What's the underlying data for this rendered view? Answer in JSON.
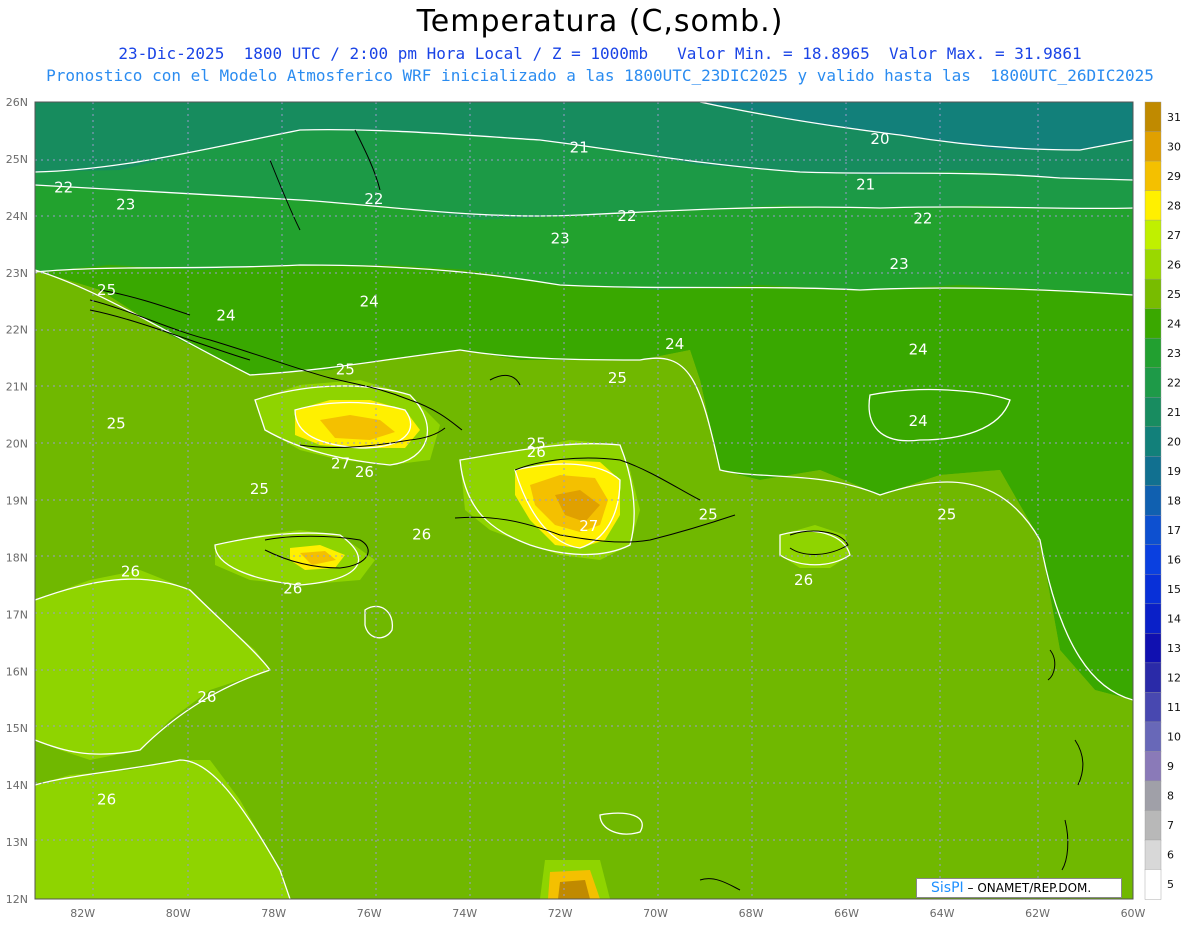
{
  "header": {
    "title": "Temperatura (C,somb.)",
    "line1": "23-Dic-2025  1800 UTC / 2:00 pm Hora Local / Z = 1000mb   Valor Min. = 18.8965  Valor Max. = 31.9861",
    "line2": "Pronostico con el Modelo Atmosferico WRF inicializado a las 1800UTC_23DIC2025 y valido hasta las  1800UTC_26DIC2025"
  },
  "map": {
    "lon_range": [
      -83,
      -60
    ],
    "lat_range": [
      12,
      26
    ],
    "lat_labels": [
      "26N",
      "25N",
      "24N",
      "23N",
      "22N",
      "21N",
      "20N",
      "19N",
      "18N",
      "17N",
      "16N",
      "15N",
      "14N",
      "13N",
      "12N"
    ],
    "lon_labels": [
      "82W",
      "80W",
      "78W",
      "76W",
      "74W",
      "72W",
      "70W",
      "68W",
      "66W",
      "64W",
      "62W",
      "60W"
    ]
  },
  "colorbar": {
    "labels": [
      "31",
      "30",
      "29",
      "28",
      "27",
      "26",
      "25",
      "24",
      "23",
      "22",
      "21",
      "20",
      "19",
      "18",
      "17",
      "16",
      "15",
      "14",
      "13",
      "12",
      "11",
      "10",
      "9",
      "8",
      "7",
      "6",
      "5"
    ],
    "colors": [
      "#c08a00",
      "#e0a000",
      "#f4c000",
      "#fff000",
      "#c0f000",
      "#9ad800",
      "#78bc00",
      "#3aa800",
      "#22a030",
      "#1e9a48",
      "#188c60",
      "#12807a",
      "#117090",
      "#1060b0",
      "#0d50d0",
      "#0a40e0",
      "#0830d8",
      "#0a20c8",
      "#1010b0",
      "#2a2aa8",
      "#4848b0",
      "#6868b8",
      "#8a7ab8",
      "#a0a0a8",
      "#b8b8b8",
      "#d8d8d8",
      "#ffffff"
    ]
  },
  "contour_labels": [
    {
      "text": "21",
      "lon": -71.6,
      "lat": 25.2
    },
    {
      "text": "20",
      "lon": -65.3,
      "lat": 25.35
    },
    {
      "text": "21",
      "lon": -65.6,
      "lat": 24.55
    },
    {
      "text": "22",
      "lon": -82.4,
      "lat": 24.5
    },
    {
      "text": "23",
      "lon": -81.1,
      "lat": 24.2
    },
    {
      "text": "22",
      "lon": -75.9,
      "lat": 24.3
    },
    {
      "text": "22",
      "lon": -70.6,
      "lat": 24.0
    },
    {
      "text": "22",
      "lon": -64.4,
      "lat": 23.95
    },
    {
      "text": "23",
      "lon": -72.0,
      "lat": 23.6
    },
    {
      "text": "23",
      "lon": -64.9,
      "lat": 23.15
    },
    {
      "text": "25",
      "lon": -81.5,
      "lat": 22.7
    },
    {
      "text": "24",
      "lon": -76.0,
      "lat": 22.5
    },
    {
      "text": "24",
      "lon": -79.0,
      "lat": 22.25
    },
    {
      "text": "24",
      "lon": -69.6,
      "lat": 21.75
    },
    {
      "text": "24",
      "lon": -64.5,
      "lat": 21.65
    },
    {
      "text": "25",
      "lon": -76.5,
      "lat": 21.3
    },
    {
      "text": "25",
      "lon": -70.8,
      "lat": 21.15
    },
    {
      "text": "25",
      "lon": -81.3,
      "lat": 20.35
    },
    {
      "text": "24",
      "lon": -64.5,
      "lat": 20.4
    },
    {
      "text": "25",
      "lon": -72.5,
      "lat": 20.0
    },
    {
      "text": "26",
      "lon": -72.5,
      "lat": 19.85
    },
    {
      "text": "27",
      "lon": -76.6,
      "lat": 19.65
    },
    {
      "text": "26",
      "lon": -76.1,
      "lat": 19.5
    },
    {
      "text": "25",
      "lon": -78.3,
      "lat": 19.2
    },
    {
      "text": "25",
      "lon": -68.9,
      "lat": 18.75
    },
    {
      "text": "25",
      "lon": -63.9,
      "lat": 18.75
    },
    {
      "text": "26",
      "lon": -74.9,
      "lat": 18.4
    },
    {
      "text": "27",
      "lon": -71.4,
      "lat": 18.55
    },
    {
      "text": "26",
      "lon": -81.0,
      "lat": 17.75
    },
    {
      "text": "26",
      "lon": -77.6,
      "lat": 17.45
    },
    {
      "text": "26",
      "lon": -66.9,
      "lat": 17.6
    },
    {
      "text": "26",
      "lon": -79.4,
      "lat": 15.55
    },
    {
      "text": "26",
      "lon": -81.5,
      "lat": 13.75
    }
  ],
  "credit": {
    "brand": "SisPI",
    "label": "ONAMET/REP.DOM."
  }
}
